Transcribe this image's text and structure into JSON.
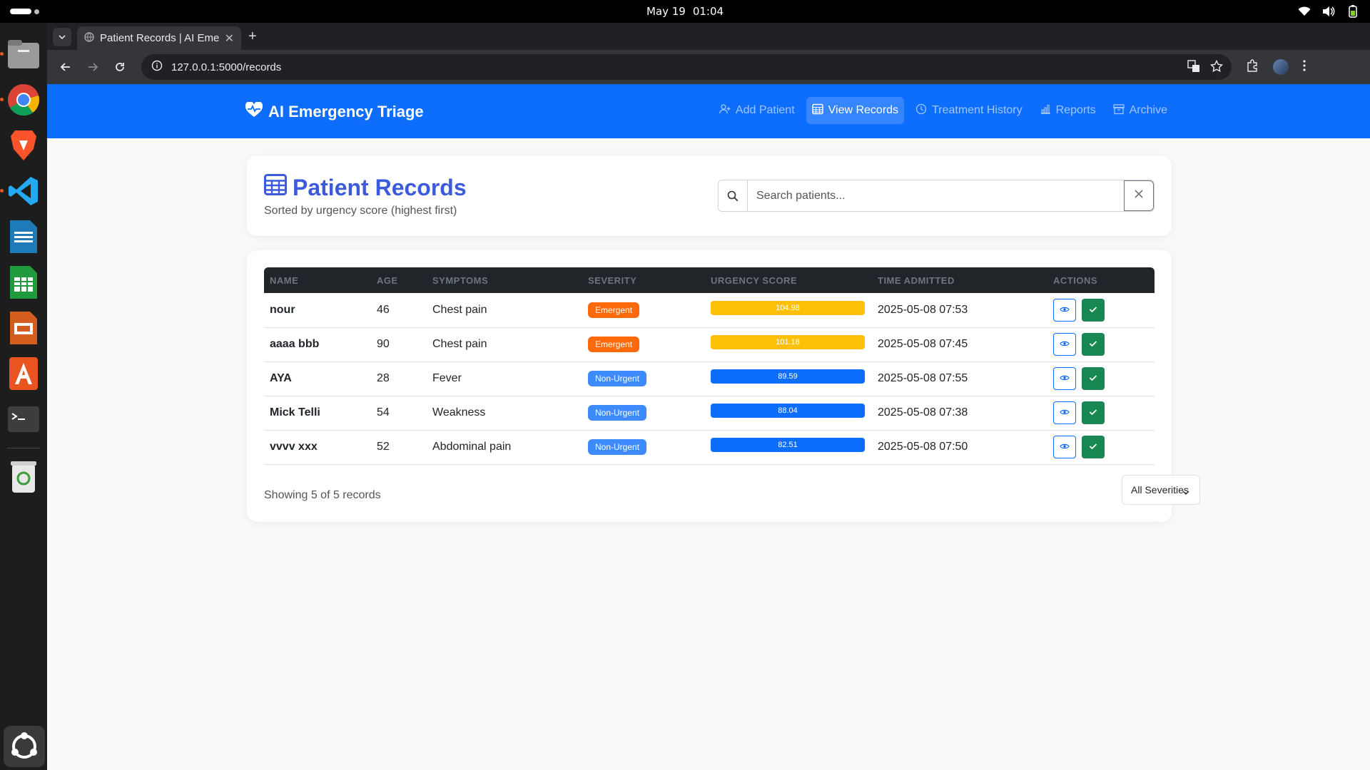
{
  "system": {
    "date": "May 19",
    "time": "01:04"
  },
  "browser": {
    "tab_title": "Patient Records | AI Eme",
    "url": "127.0.0.1:5000/records"
  },
  "app": {
    "brand": "AI Emergency Triage",
    "nav": [
      {
        "label": "Add Patient",
        "icon": "person-add-icon",
        "active": false
      },
      {
        "label": "View Records",
        "icon": "table-icon",
        "active": true
      },
      {
        "label": "Treatment History",
        "icon": "clock-icon",
        "active": false
      },
      {
        "label": "Reports",
        "icon": "bar-chart-icon",
        "active": false
      },
      {
        "label": "Archive",
        "icon": "archive-icon",
        "active": false
      }
    ]
  },
  "header": {
    "title": "Patient Records",
    "subtitle": "Sorted by urgency score (highest first)",
    "search_placeholder": "Search patients..."
  },
  "table": {
    "columns": [
      "NAME",
      "AGE",
      "SYMPTOMS",
      "SEVERITY",
      "URGENCY SCORE",
      "TIME ADMITTED",
      "ACTIONS"
    ],
    "rows": [
      {
        "name": "nour",
        "age": "46",
        "symptoms": "Chest pain",
        "severity": "Emergent",
        "urgency": "104.98",
        "admitted": "2025-05-08 07:53"
      },
      {
        "name": "aaaa bbb",
        "age": "90",
        "symptoms": "Chest pain",
        "severity": "Emergent",
        "urgency": "101.18",
        "admitted": "2025-05-08 07:45"
      },
      {
        "name": "AYA",
        "age": "28",
        "symptoms": "Fever",
        "severity": "Non-Urgent",
        "urgency": "89.59",
        "admitted": "2025-05-08 07:55"
      },
      {
        "name": "Mick Telli",
        "age": "54",
        "symptoms": "Weakness",
        "severity": "Non-Urgent",
        "urgency": "88.04",
        "admitted": "2025-05-08 07:38"
      },
      {
        "name": "vvvv xxx",
        "age": "52",
        "symptoms": "Abdominal pain",
        "severity": "Non-Urgent",
        "urgency": "82.51",
        "admitted": "2025-05-08 07:50"
      }
    ]
  },
  "footer": {
    "showing": "Showing 5 of 5 records",
    "filter_value": "All Severities"
  },
  "colors": {
    "primary": "#0d6efd",
    "title": "#3b5bdb",
    "emergent_badge": "#fd6a0d",
    "nonurgent_badge": "#3d8bfd",
    "emergent_bar": "#ffc107",
    "nonurgent_bar": "#0d6efd",
    "success": "#198754"
  }
}
